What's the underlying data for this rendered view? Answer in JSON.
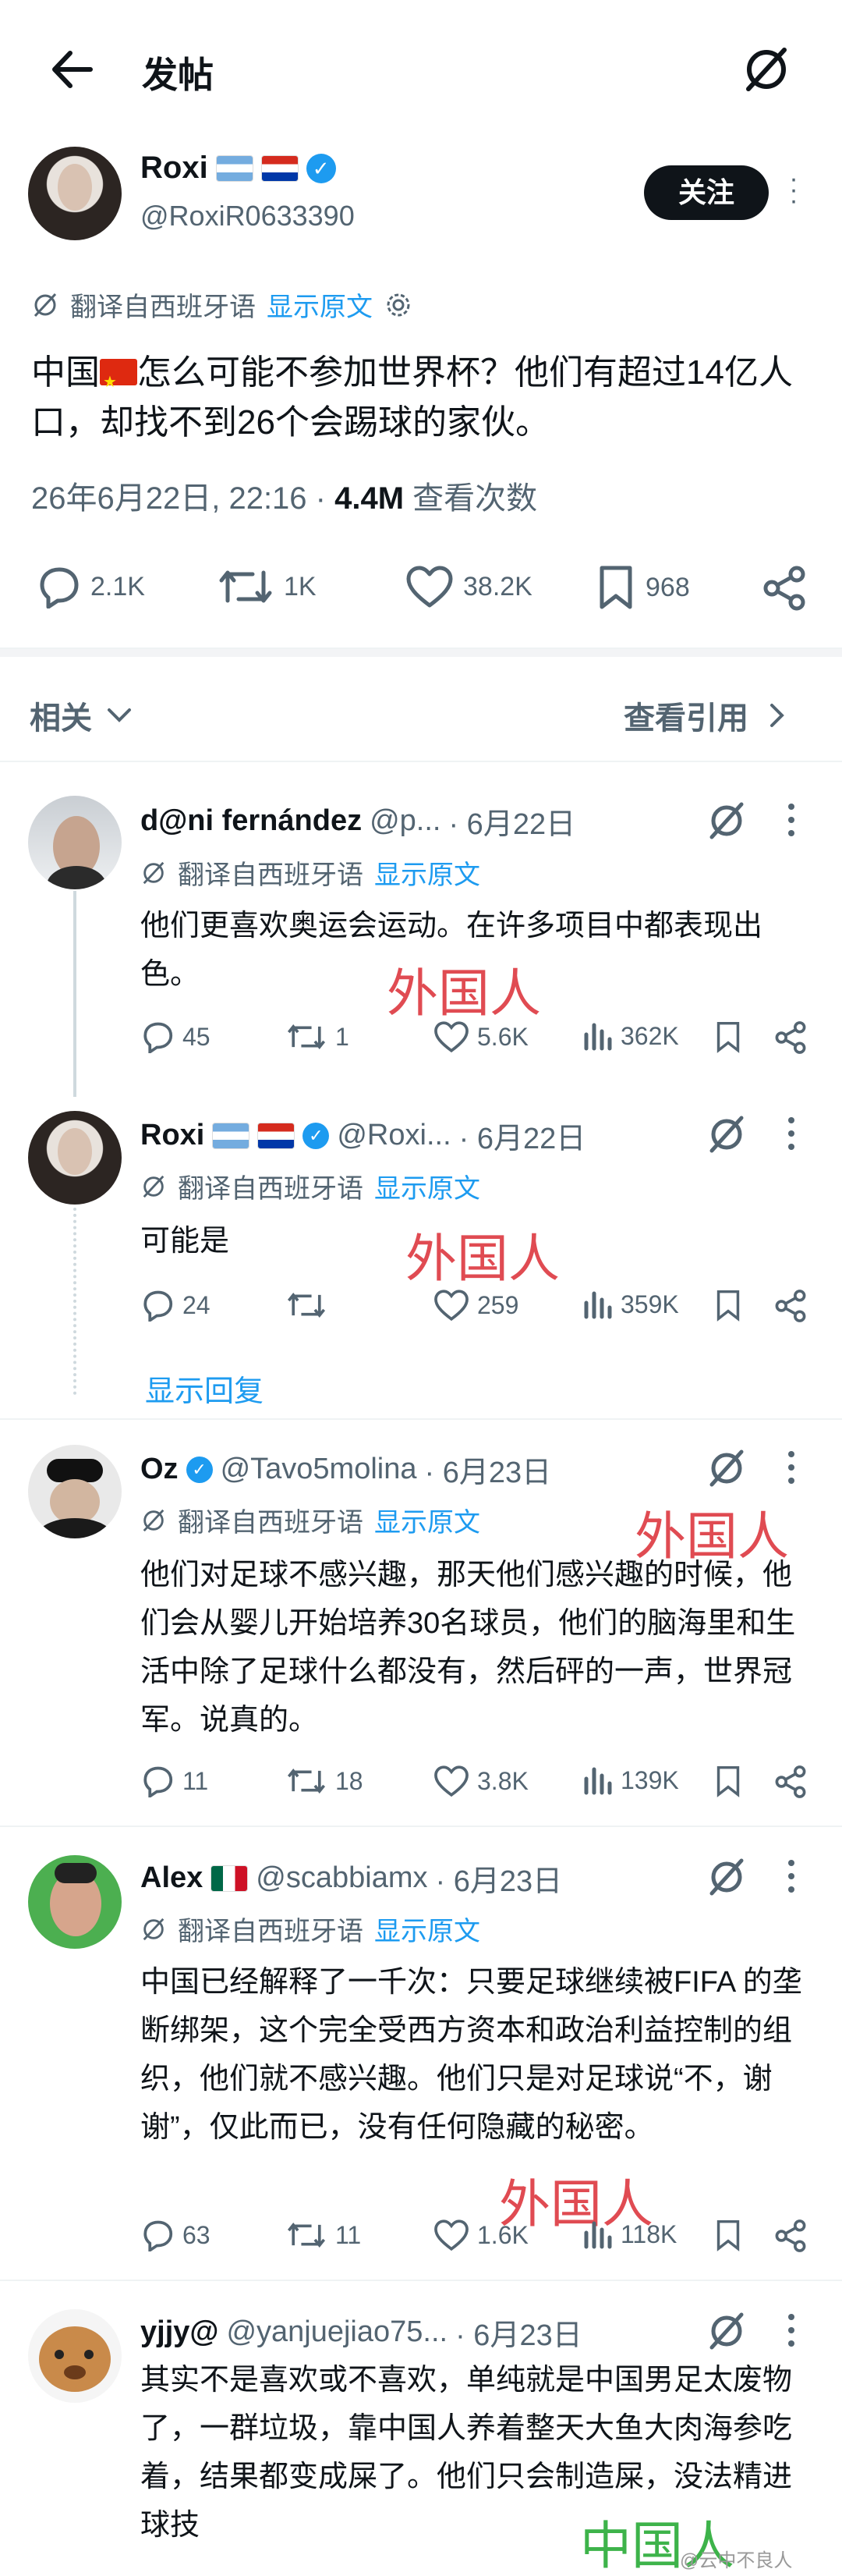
{
  "header": {
    "title": "发帖"
  },
  "main_post": {
    "name": "Roxi",
    "handle": "@RoxiR0633390",
    "follow_label": "关注",
    "translated_from": "翻译自西班牙语",
    "show_original": "显示原文",
    "text_part1": "中国",
    "text_part2": "怎么可能不参加世界杯？他们有超过14亿人口，却找不到26个会踢球的家伙。",
    "timestamp": "26年6月22日, 22:16 · ",
    "views_count": "4.4M",
    "views_label": " 查看次数",
    "replies": "2.1K",
    "reposts": "1K",
    "likes": "38.2K",
    "bookmarks": "968"
  },
  "related_bar": {
    "related_label": "相关",
    "quotes_label": "查看引用"
  },
  "replies": [
    {
      "name": "d@ni fernández",
      "handle": "@p...",
      "date": "· 6月22日",
      "translated_from": "翻译自西班牙语",
      "show_original": "显示原文",
      "text": "他们更喜欢奥运会运动。在许多项目中都表现出色。",
      "replies": "45",
      "reposts": "1",
      "likes": "5.6K",
      "views": "362K",
      "annotation": "外国人"
    },
    {
      "name": "Roxi",
      "handle": "@Roxi...",
      "date": "· 6月22日",
      "translated_from": "翻译自西班牙语",
      "show_original": "显示原文",
      "text": "可能是",
      "replies": "24",
      "reposts": "",
      "likes": "259",
      "views": "359K",
      "annotation": "外国人"
    },
    {
      "name": "Oz",
      "handle": "@Tavo5molina",
      "date": "· 6月23日",
      "translated_from": "翻译自西班牙语",
      "show_original": "显示原文",
      "text": "他们对足球不感兴趣，那天他们感兴趣的时候，他们会从婴儿开始培养30名球员，他们的脑海里和生活中除了足球什么都没有，然后砰的一声，世界冠军。说真的。",
      "replies": "11",
      "reposts": "18",
      "likes": "3.8K",
      "views": "139K",
      "annotation": "外国人"
    },
    {
      "name": "Alex",
      "handle": "@scabbiamx",
      "date": "· 6月23日",
      "translated_from": "翻译自西班牙语",
      "show_original": "显示原文",
      "text": "中国已经解释了一千次：只要足球继续被FIFA 的垄断绑架，这个完全受西方资本和政治利益控制的组织，他们就不感兴趣。他们只是对足球说“不，谢谢”，仅此而已，没有任何隐藏的秘密。",
      "replies": "63",
      "reposts": "11",
      "likes": "1.6K",
      "views": "118K",
      "annotation": "外国人"
    },
    {
      "name": "yjjy@",
      "handle": "@yanjuejiao75...",
      "date": "· 6月23日",
      "text": "其实不是喜欢或不喜欢，单纯就是中国男足太废物了，一群垃圾，靠中国人养着整天大鱼大肉海参吃着，结果都变成屎了。他们只会制造屎，没法精进球技",
      "annotation": "中国人"
    }
  ],
  "show_replies_label": "显示回复",
  "watermark": "@云中不良人",
  "colors": {
    "accent": "#1d9bf0",
    "text": "#0f1419",
    "muted": "#536471",
    "annot_red": "#e04b52",
    "annot_green": "#3db34a"
  }
}
